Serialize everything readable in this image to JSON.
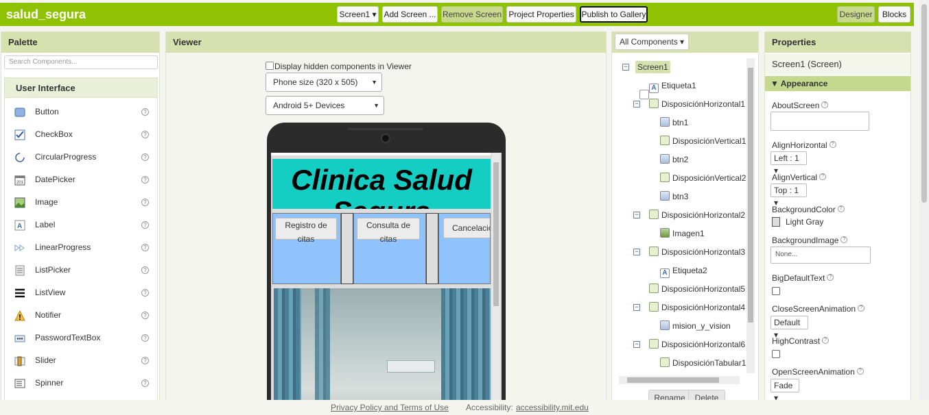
{
  "header": {
    "app_title": "salud_segura",
    "screen_selector": "Screen1 ▾",
    "add_screen": "Add Screen ...",
    "remove_screen": "Remove Screen",
    "project_properties": "Project Properties",
    "publish_gallery": "Publish to Gallery",
    "designer": "Designer",
    "blocks": "Blocks"
  },
  "palette": {
    "title": "Palette",
    "search_placeholder": "Search Components...",
    "category": "User Interface",
    "items": [
      {
        "label": "Button",
        "icon": "button-icon"
      },
      {
        "label": "CheckBox",
        "icon": "checkbox-icon"
      },
      {
        "label": "CircularProgress",
        "icon": "circular-progress-icon"
      },
      {
        "label": "DatePicker",
        "icon": "datepicker-icon"
      },
      {
        "label": "Image",
        "icon": "image-icon"
      },
      {
        "label": "Label",
        "icon": "label-icon"
      },
      {
        "label": "LinearProgress",
        "icon": "linear-progress-icon"
      },
      {
        "label": "ListPicker",
        "icon": "listpicker-icon"
      },
      {
        "label": "ListView",
        "icon": "listview-icon"
      },
      {
        "label": "Notifier",
        "icon": "notifier-icon"
      },
      {
        "label": "PasswordTextBox",
        "icon": "password-icon"
      },
      {
        "label": "Slider",
        "icon": "slider-icon"
      },
      {
        "label": "Spinner",
        "icon": "spinner-icon"
      }
    ]
  },
  "viewer": {
    "title": "Viewer",
    "display_hidden": "Display hidden components in Viewer",
    "phone_size": "Phone size (320 x 505)",
    "android_version": "Android 5+ Devices",
    "app": {
      "title_text": "Clinica Salud Segura",
      "btn1": "Registro de citas",
      "btn2": "Consulta de citas",
      "btn3": "Cancelación"
    }
  },
  "components": {
    "filter": "All Components ▾",
    "tree": [
      {
        "label": "Screen1",
        "kind": "screen",
        "toggle": "⊟"
      },
      {
        "label": "Etiqueta1",
        "kind": "label"
      },
      {
        "label": "DisposiciónHorizontal1",
        "kind": "hz",
        "toggle": "⊟"
      },
      {
        "label": "btn1",
        "kind": "button"
      },
      {
        "label": "DisposiciónVertical1",
        "kind": "vz"
      },
      {
        "label": "btn2",
        "kind": "button"
      },
      {
        "label": "DisposiciónVertical2",
        "kind": "vz"
      },
      {
        "label": "btn3",
        "kind": "button"
      },
      {
        "label": "DisposiciónHorizontal2",
        "kind": "hz",
        "toggle": "⊟"
      },
      {
        "label": "Imagen1",
        "kind": "img"
      },
      {
        "label": "DisposiciónHorizontal3",
        "kind": "hz",
        "toggle": "⊟"
      },
      {
        "label": "Etiqueta2",
        "kind": "label"
      },
      {
        "label": "DisposiciónHorizontal5",
        "kind": "hz"
      },
      {
        "label": "DisposiciónHorizontal4",
        "kind": "hz",
        "toggle": "⊟"
      },
      {
        "label": "mision_y_vision",
        "kind": "button"
      },
      {
        "label": "DisposiciónHorizontal6",
        "kind": "hz",
        "toggle": "⊟"
      },
      {
        "label": "DisposiciónTabular1",
        "kind": "table"
      }
    ],
    "rename": "Rename",
    "delete": "Delete"
  },
  "properties": {
    "title": "Properties",
    "subtitle": "Screen1 (Screen)",
    "group": "Appearance",
    "about_screen": "AboutScreen",
    "align_horizontal": "AlignHorizontal",
    "align_horizontal_value": "Left : 1 ▾",
    "align_vertical": "AlignVertical",
    "align_vertical_value": "Top : 1 ▾",
    "background_color": "BackgroundColor",
    "background_color_value": "Light Gray",
    "background_image": "BackgroundImage",
    "background_image_value": "None...",
    "big_default_text": "BigDefaultText",
    "close_screen_animation": "CloseScreenAnimation",
    "close_screen_animation_value": "Default ▾",
    "high_contrast": "HighContrast",
    "open_screen_animation": "OpenScreenAnimation",
    "open_screen_animation_value": "Fade ▾"
  },
  "footer": {
    "privacy": "Privacy Policy and Terms of Use",
    "accessibility_label": "Accessibility:",
    "accessibility_link": "accessibility.mit.edu"
  },
  "colors": {
    "brand_green": "#8fc202",
    "panel_header": "#d5e2b0",
    "title_cyan": "#14cdc3",
    "button_cell_blue": "#90c3fb"
  }
}
